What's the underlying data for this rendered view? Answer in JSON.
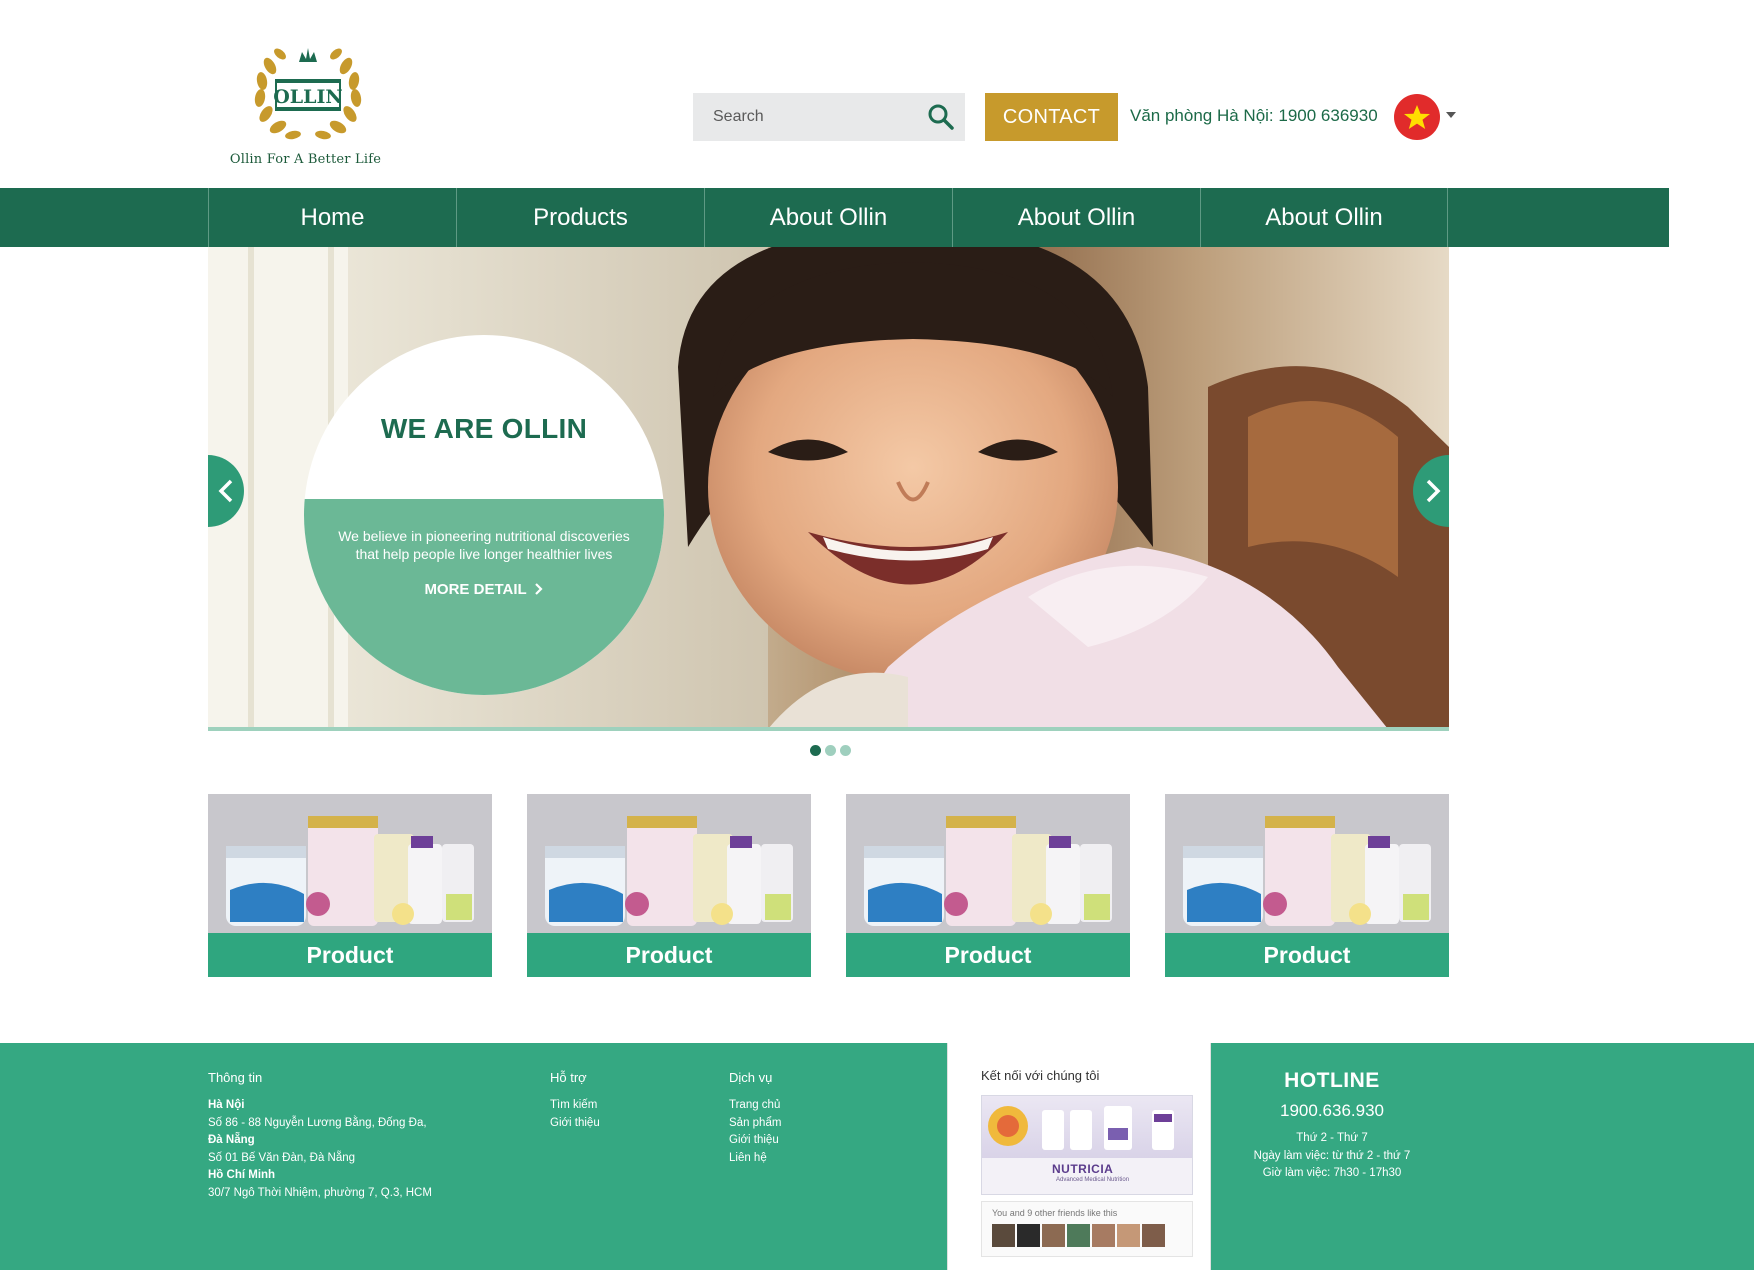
{
  "brand": {
    "logo_text": "OLLIN",
    "tagline": "Ollin For A Better Life"
  },
  "header": {
    "search_placeholder": "Search",
    "contact_label": "CONTACT",
    "office_phone": "Văn phòng Hà Nội: 1900 636930",
    "language_flag": "vietnam-flag-icon"
  },
  "nav": {
    "items": [
      {
        "label": "Home"
      },
      {
        "label": "Products"
      },
      {
        "label": "About Ollin"
      },
      {
        "label": "About Ollin"
      },
      {
        "label": "About Ollin"
      }
    ]
  },
  "hero": {
    "title": "WE ARE OLLIN",
    "text_line1": "We believe in pioneering nutritional discoveries",
    "text_line2": "that help people live longer healthier lives",
    "more_label": "MORE DETAIL",
    "slides_total": 3,
    "active_slide": 1
  },
  "products": [
    {
      "label": "Product"
    },
    {
      "label": "Product"
    },
    {
      "label": "Product"
    },
    {
      "label": "Product"
    }
  ],
  "footer": {
    "info": {
      "heading": "Thông tin",
      "hanoi_title": "Hà Nội",
      "hanoi_address": "Số 86 - 88 Nguyễn Lương Bằng, Đống Đa,",
      "danang_title": "Đà Nẵng",
      "danang_address": "Số 01 Bế Văn Đàn, Đà Nẵng",
      "hcm_title": "Hồ Chí Minh",
      "hcm_address": "30/7 Ngô Thời Nhiệm, phường 7, Q.3, HCM"
    },
    "support": {
      "heading": "Hỗ trợ",
      "links": [
        "Tìm kiếm",
        "Giới thiệu"
      ]
    },
    "services": {
      "heading": "Dịch vụ",
      "links": [
        "Trang chủ",
        "Sản phẩm",
        "Giới thiệu",
        "Liên hệ"
      ]
    },
    "social": {
      "title": "Kết nối với chúng tôi",
      "brand": "NUTRICIA",
      "brand_sub": "Advanced Medical Nutrition",
      "friends_text": "You and 9 other friends like this"
    },
    "hotline": {
      "title": "HOTLINE",
      "number": "1900.636.930",
      "days": "Thứ 2 - Thứ 7",
      "work_days": "Ngày làm việc: từ thứ 2 - thứ 7",
      "work_hours": "Giờ làm việc: 7h30 - 17h30"
    }
  },
  "colors": {
    "primary_green": "#1d6b50",
    "accent_green": "#35a882",
    "gold": "#c79a2c"
  }
}
